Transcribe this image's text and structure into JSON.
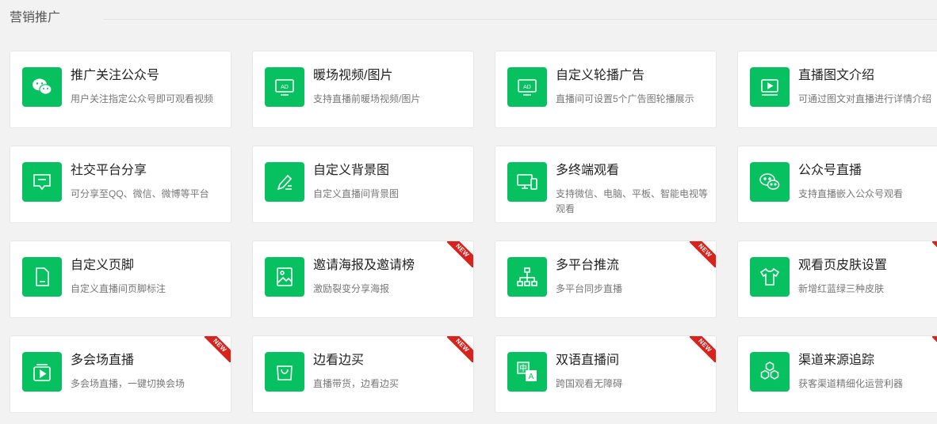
{
  "section": {
    "title": "营销推广"
  },
  "colors": {
    "accent": "#07c160",
    "ribbon": "#d9221c"
  },
  "badge_label": "NEW",
  "cards": [
    {
      "title": "推广关注公众号",
      "desc": "用户关注指定公众号即可观看视频",
      "icon": "wechat-icon",
      "new": false
    },
    {
      "title": "暖场视频/图片",
      "desc": "支持直播前暖场视频/图片",
      "icon": "ad-screen-icon",
      "new": false
    },
    {
      "title": "自定义轮播广告",
      "desc": "直播间可设置5个广告图轮播展示",
      "icon": "ad-carousel-icon",
      "new": false
    },
    {
      "title": "直播图文介绍",
      "desc": "可通过图文对直播进行详情介绍",
      "icon": "video-play-icon",
      "new": false
    },
    {
      "title": "社交平台分享",
      "desc": "可分享至QQ、微信、微博等平台",
      "icon": "share-icon",
      "new": false
    },
    {
      "title": "自定义背景图",
      "desc": "自定义直播间背景图",
      "icon": "pencil-icon",
      "new": false
    },
    {
      "title": "多终端观看",
      "desc": "支持微信、电脑、平板、智能电视等观看",
      "icon": "devices-icon",
      "new": false
    },
    {
      "title": "公众号直播",
      "desc": "支持直播嵌入公众号观看",
      "icon": "wechat-outline-icon",
      "new": false
    },
    {
      "title": "自定义页脚",
      "desc": "自定义直播间页脚标注",
      "icon": "document-icon",
      "new": false
    },
    {
      "title": "邀请海报及邀请榜",
      "desc": "激励裂变分享海报",
      "icon": "poster-icon",
      "new": true
    },
    {
      "title": "多平台推流",
      "desc": "多平台同步直播",
      "icon": "network-icon",
      "new": true
    },
    {
      "title": "观看页皮肤设置",
      "desc": "新增红蓝绿三种皮肤",
      "icon": "tshirt-icon",
      "new": true
    },
    {
      "title": "多会场直播",
      "desc": "多会场直播，一键切换会场",
      "icon": "multi-venue-icon",
      "new": true
    },
    {
      "title": "边看边买",
      "desc": "直播带货，边看边买",
      "icon": "shopping-bag-icon",
      "new": true
    },
    {
      "title": "双语直播间",
      "desc": "跨国观看无障碍",
      "icon": "translate-icon",
      "new": true
    },
    {
      "title": "渠道来源追踪",
      "desc": "获客渠道精细化运营利器",
      "icon": "hexagons-icon",
      "new": true
    }
  ]
}
